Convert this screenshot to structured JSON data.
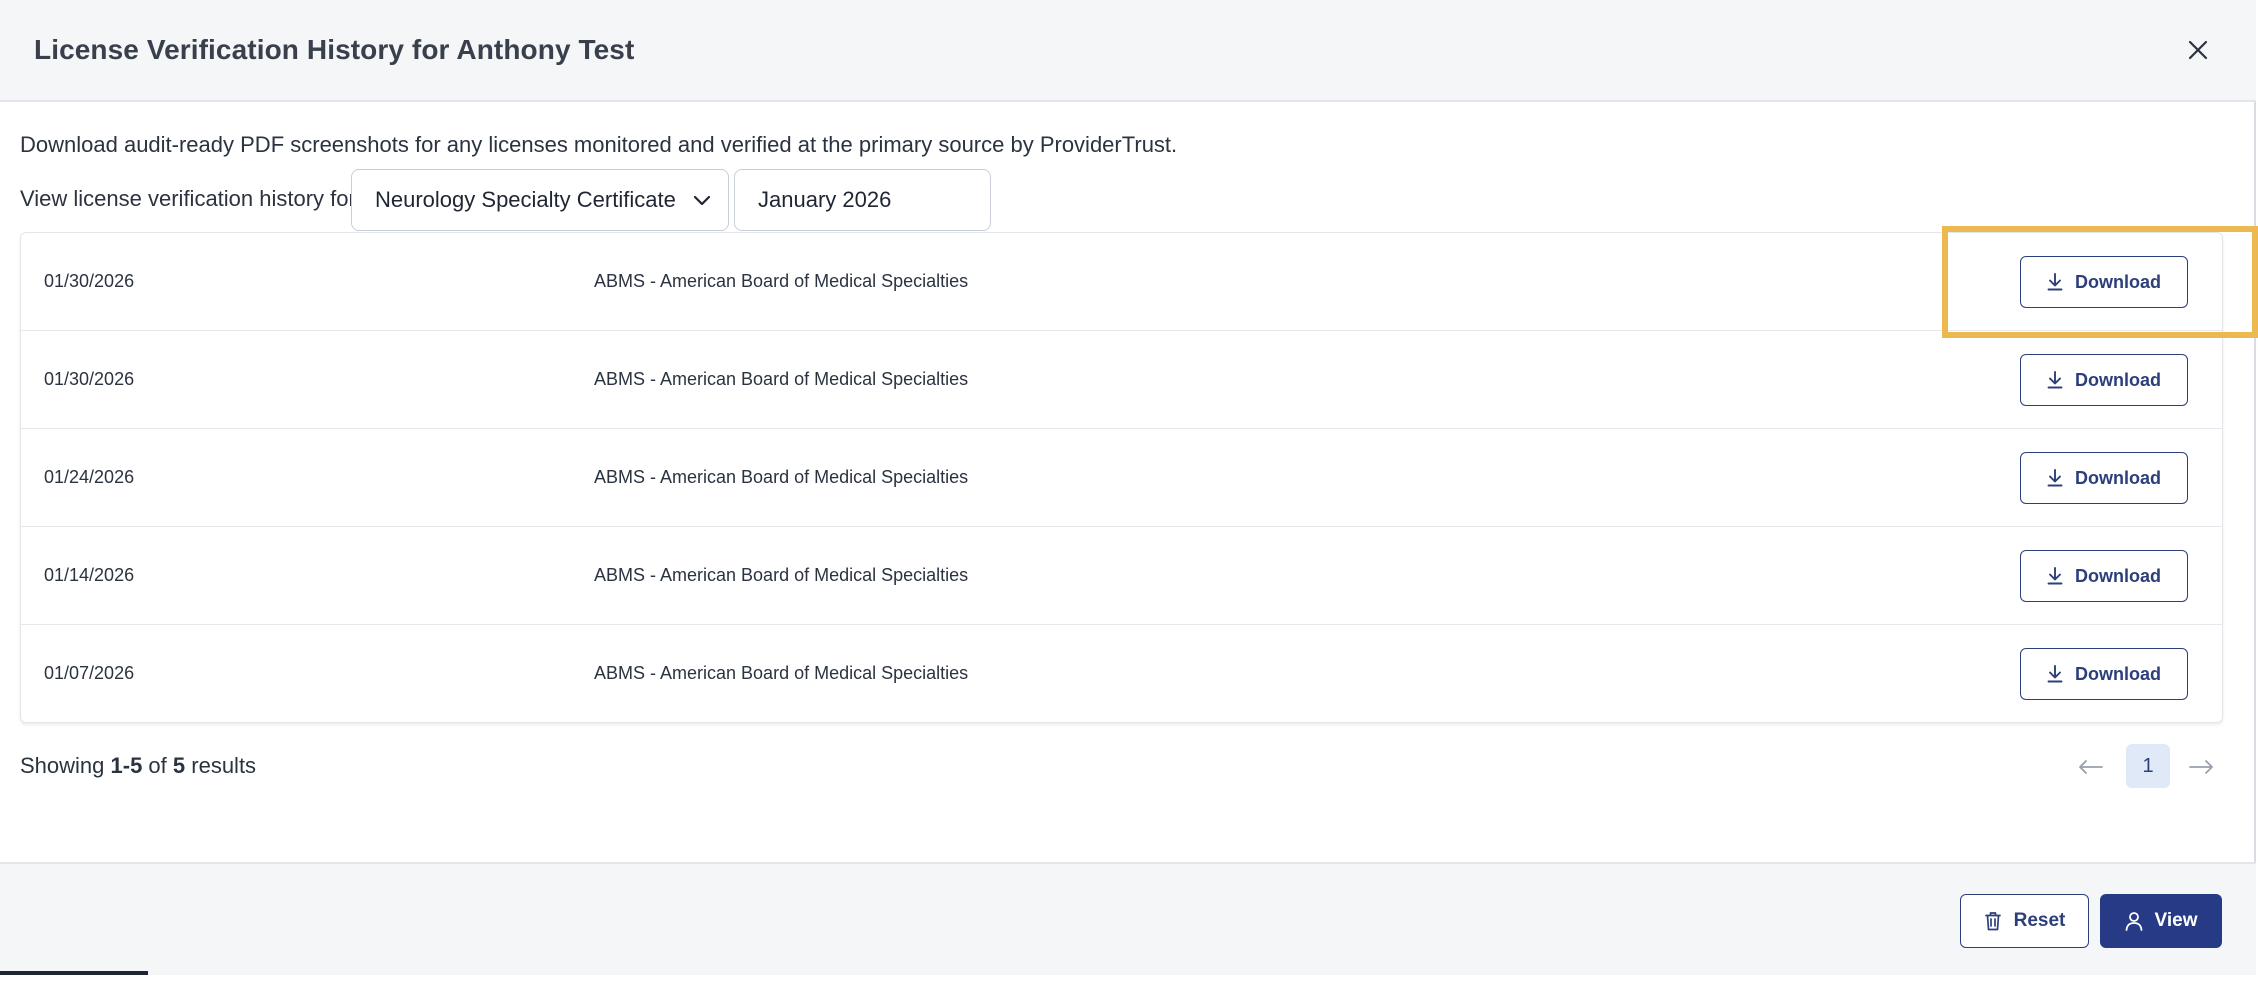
{
  "modal": {
    "title": "License Verification History for Anthony Test",
    "intro": "Download audit-ready PDF screenshots for any licenses monitored and verified at the primary source by ProviderTrust.",
    "filter_label": "View license verification history for:",
    "license_select": {
      "selected": "Neurology Specialty Certificate"
    },
    "month_field": {
      "value": "January 2026"
    }
  },
  "table": {
    "rows": [
      {
        "date": "01/30/2026",
        "source": "ABMS - American Board of Medical Specialties",
        "action": "Download"
      },
      {
        "date": "01/30/2026",
        "source": "ABMS - American Board of Medical Specialties",
        "action": "Download"
      },
      {
        "date": "01/24/2026",
        "source": "ABMS - American Board of Medical Specialties",
        "action": "Download"
      },
      {
        "date": "01/14/2026",
        "source": "ABMS - American Board of Medical Specialties",
        "action": "Download"
      },
      {
        "date": "01/07/2026",
        "source": "ABMS - American Board of Medical Specialties",
        "action": "Download"
      }
    ]
  },
  "pagination": {
    "prefix": "Showing ",
    "range": "1-5",
    "of": " of ",
    "total": "5",
    "suffix": " results",
    "current_page": "1"
  },
  "footer": {
    "reset_label": "Reset",
    "view_label": "View"
  },
  "colors": {
    "accent": "#263a86",
    "highlight": "#ebb94f",
    "page_active_bg": "#dfe9f7"
  },
  "icons": {
    "close": "close-icon",
    "chevron": "chevron-down-icon",
    "download": "download-icon",
    "prev": "arrow-left-icon",
    "next": "arrow-right-icon",
    "reset": "trash-icon",
    "view": "user-icon"
  }
}
